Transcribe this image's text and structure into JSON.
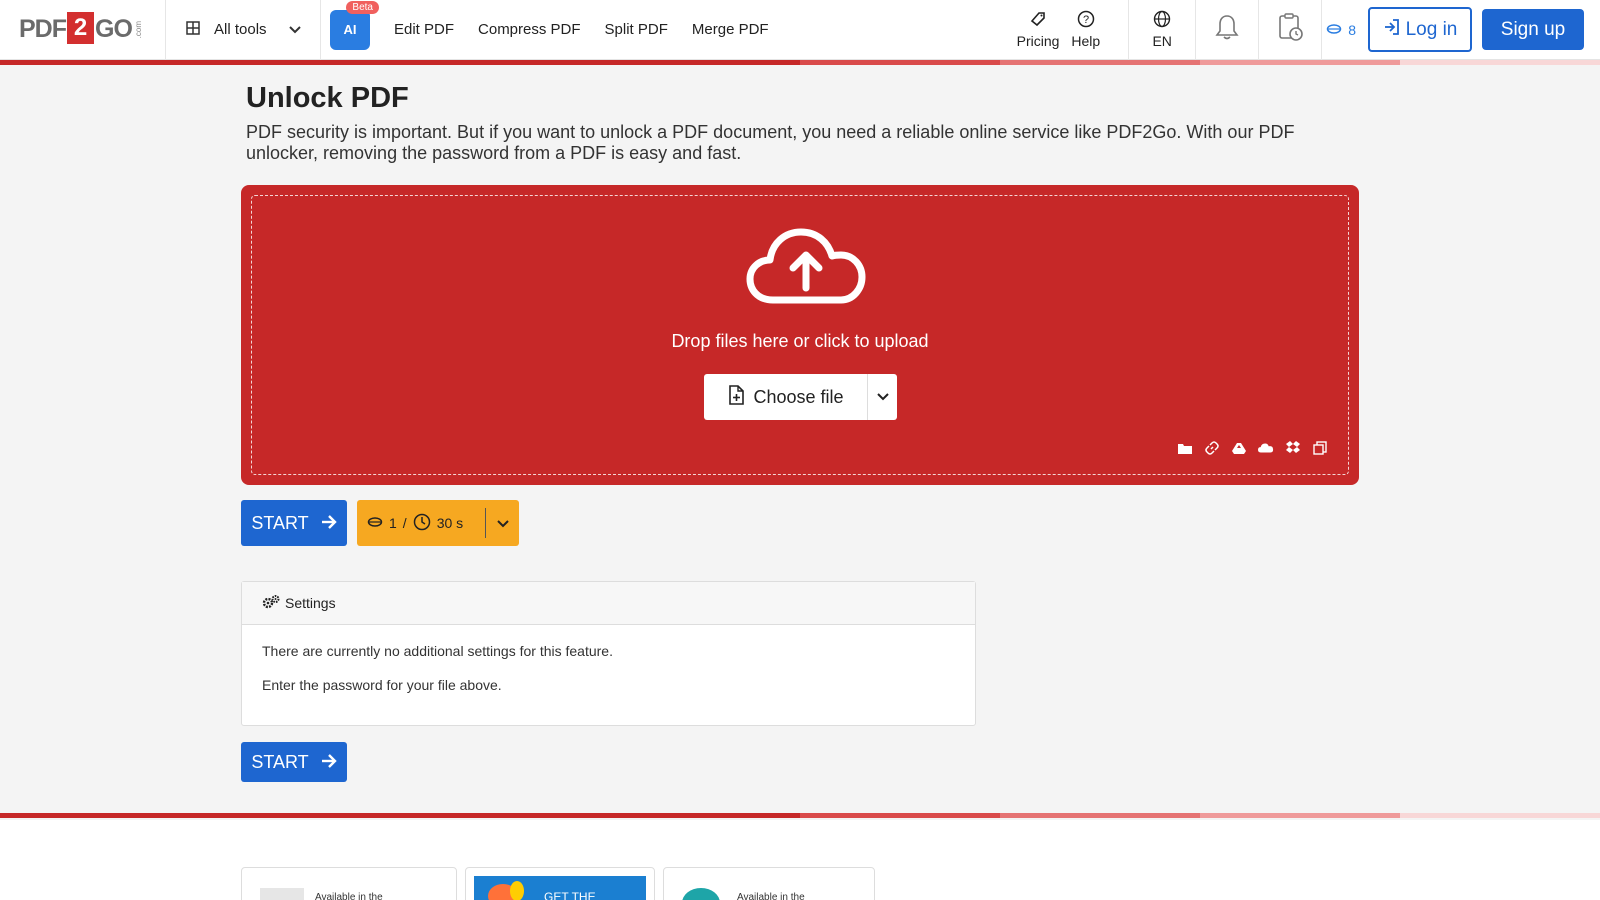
{
  "header": {
    "logo": {
      "pdf": "PDF",
      "two": "2",
      "go": "GO",
      "com": ".com"
    },
    "all_tools_label": "All tools",
    "ai_badge": "Beta",
    "ai_label": "AI",
    "nav": [
      "Edit PDF",
      "Compress PDF",
      "Split PDF",
      "Merge PDF"
    ],
    "pricing_label": "Pricing",
    "help_label": "Help",
    "language": "EN",
    "credits": "8",
    "login_label": "Log in",
    "signup_label": "Sign up"
  },
  "main": {
    "title": "Unlock PDF",
    "description": "PDF security is important. But if you want to unlock a PDF document, you need a reliable online service like PDF2Go. With our PDF unlocker, removing the password from a PDF is easy and fast.",
    "drop_text": "Drop files here or click to upload",
    "choose_file_label": "Choose file",
    "start_label": "START",
    "cost": {
      "credits": "1",
      "separator": "/",
      "time": "30 s"
    },
    "settings": {
      "header": "Settings",
      "line1": "There are currently no additional settings for this feature.",
      "line2": "Enter the password for your file above."
    }
  },
  "footer": {
    "ext1_label": "Available in the",
    "ext2_label": "GET THE",
    "ext3_label": "Available in the"
  },
  "colors": {
    "brand_red": "#c62828",
    "primary_blue": "#1e66d0",
    "cost_orange": "#f6a821"
  }
}
